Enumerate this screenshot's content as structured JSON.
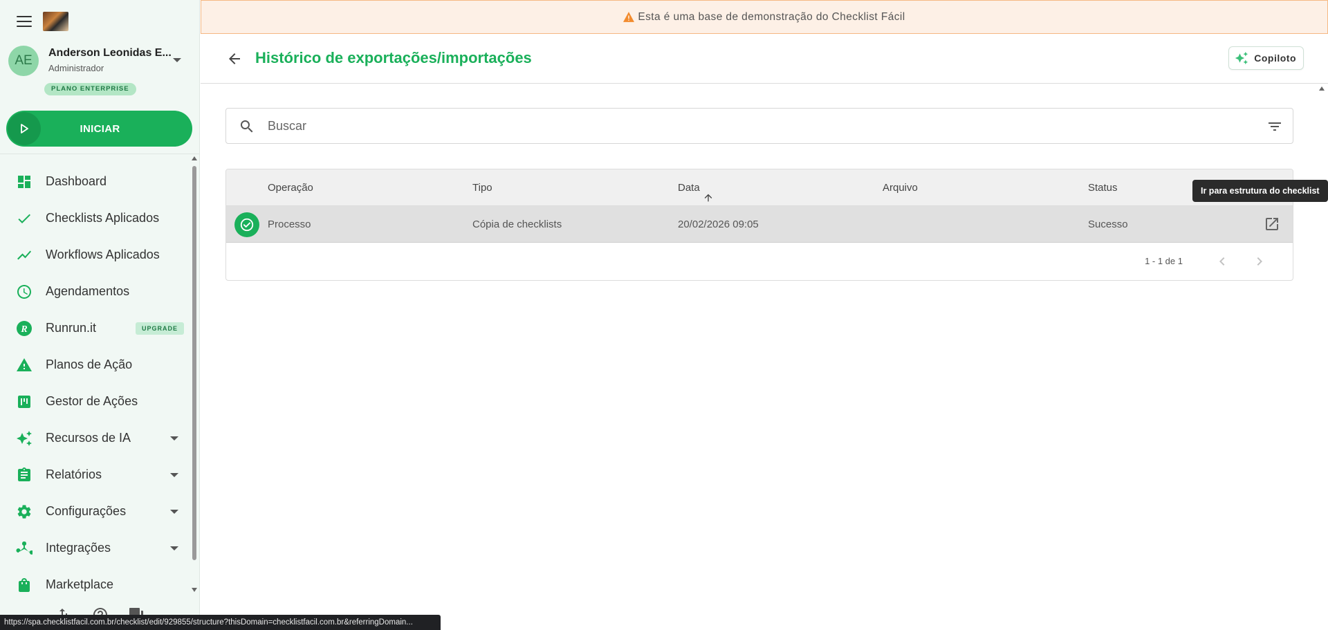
{
  "sidebar": {
    "user": {
      "initials": "AE",
      "name": "Anderson Leonidas E...",
      "role": "Administrador",
      "plan": "PLANO ENTERPRISE"
    },
    "start_label": "INICIAR",
    "items": [
      {
        "label": "Dashboard",
        "icon": "dashboard-icon"
      },
      {
        "label": "Checklists Aplicados",
        "icon": "check-icon"
      },
      {
        "label": "Workflows Aplicados",
        "icon": "trending-icon"
      },
      {
        "label": "Agendamentos",
        "icon": "clock-icon"
      },
      {
        "label": "Runrun.it",
        "icon": "runrun-icon",
        "badge": "UPGRADE"
      },
      {
        "label": "Planos de Ação",
        "icon": "warning-icon"
      },
      {
        "label": "Gestor de Ações",
        "icon": "kanban-icon"
      },
      {
        "label": "Recursos de IA",
        "icon": "sparkle-icon"
      },
      {
        "label": "Relatórios",
        "icon": "clipboard-icon"
      },
      {
        "label": "Configurações",
        "icon": "gear-icon"
      },
      {
        "label": "Integrações",
        "icon": "integration-icon"
      },
      {
        "label": "Marketplace",
        "icon": "shopping-bag-icon"
      }
    ]
  },
  "status_url": "https://spa.checklistfacil.com.br/checklist/edit/929855/structure?thisDomain=checklistfacil.com.br&referringDomain...",
  "banner": {
    "text": "Esta é uma base de demonstração do Checklist Fácil"
  },
  "header": {
    "title": "Histórico de exportações/importações",
    "copilot_label": "Copiloto"
  },
  "search": {
    "placeholder": "Buscar"
  },
  "table": {
    "columns": [
      "Operação",
      "Tipo",
      "Data",
      "Arquivo",
      "Status"
    ],
    "sorted_column": "Data",
    "rows": [
      {
        "operacao": "Processo",
        "tipo": "Cópia de checklists",
        "data": "20/02/2026 09:05",
        "arquivo": "",
        "status": "Sucesso"
      }
    ],
    "pagination": "1 - 1 de 1"
  },
  "tooltip": "Ir para estrutura do checklist",
  "colors": {
    "accent": "#1ab05a",
    "banner_bg": "#fdf0e6",
    "banner_border": "#f5b882",
    "sidebar_bg": "#f1f8f4"
  }
}
